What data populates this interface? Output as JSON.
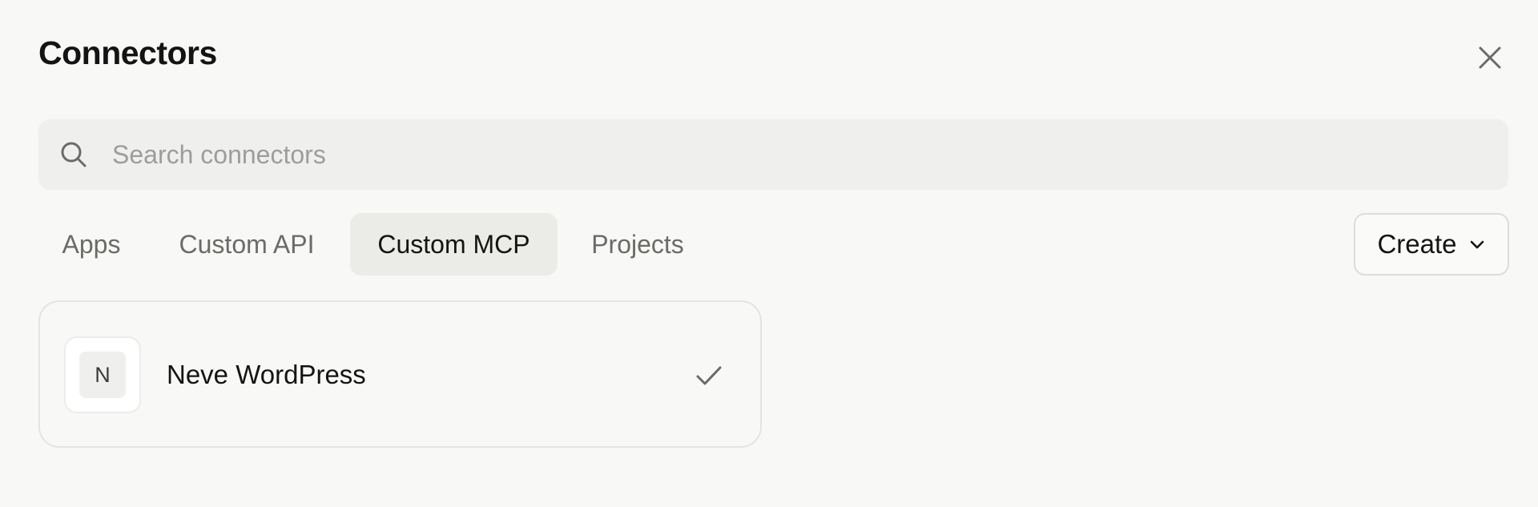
{
  "dialog": {
    "title": "Connectors"
  },
  "search": {
    "placeholder": "Search connectors",
    "value": ""
  },
  "tabs": [
    {
      "label": "Apps",
      "active": false
    },
    {
      "label": "Custom API",
      "active": false
    },
    {
      "label": "Custom MCP",
      "active": true
    },
    {
      "label": "Projects",
      "active": false
    }
  ],
  "create_button": {
    "label": "Create"
  },
  "connectors": [
    {
      "initial": "N",
      "name": "Neve WordPress",
      "status_icon": "check-icon"
    }
  ],
  "colors": {
    "background": "#f8f8f6",
    "active_tab_bg": "#ebebe8",
    "search_bg": "#efefed"
  }
}
